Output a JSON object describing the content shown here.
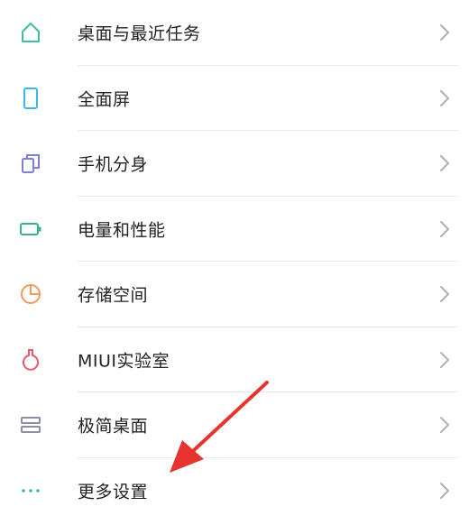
{
  "settings_list": {
    "items": [
      {
        "label": "桌面与最近任务",
        "icon": "home-icon",
        "icon_color": "#3fbfa3"
      },
      {
        "label": "全面屏",
        "icon": "phone-icon",
        "icon_color": "#3bb6e8"
      },
      {
        "label": "手机分身",
        "icon": "dual-app-icon",
        "icon_color": "#7b7fd8"
      },
      {
        "label": "电量和性能",
        "icon": "battery-icon",
        "icon_color": "#35b58e"
      },
      {
        "label": "存储空间",
        "icon": "storage-pie-icon",
        "icon_color": "#f39a5c"
      },
      {
        "label": "MIUI实验室",
        "icon": "flask-icon",
        "icon_color": "#e85a6a"
      },
      {
        "label": "极简桌面",
        "icon": "simple-mode-icon",
        "icon_color": "#8a8fa6"
      },
      {
        "label": "更多设置",
        "icon": "more-dots-icon",
        "icon_color": "#3fb7a6"
      }
    ]
  },
  "colors": {
    "text": "#222222",
    "chevron": "#b0b0b0",
    "divider": "#e9e9e9",
    "annotation_arrow": "#e8342e"
  }
}
